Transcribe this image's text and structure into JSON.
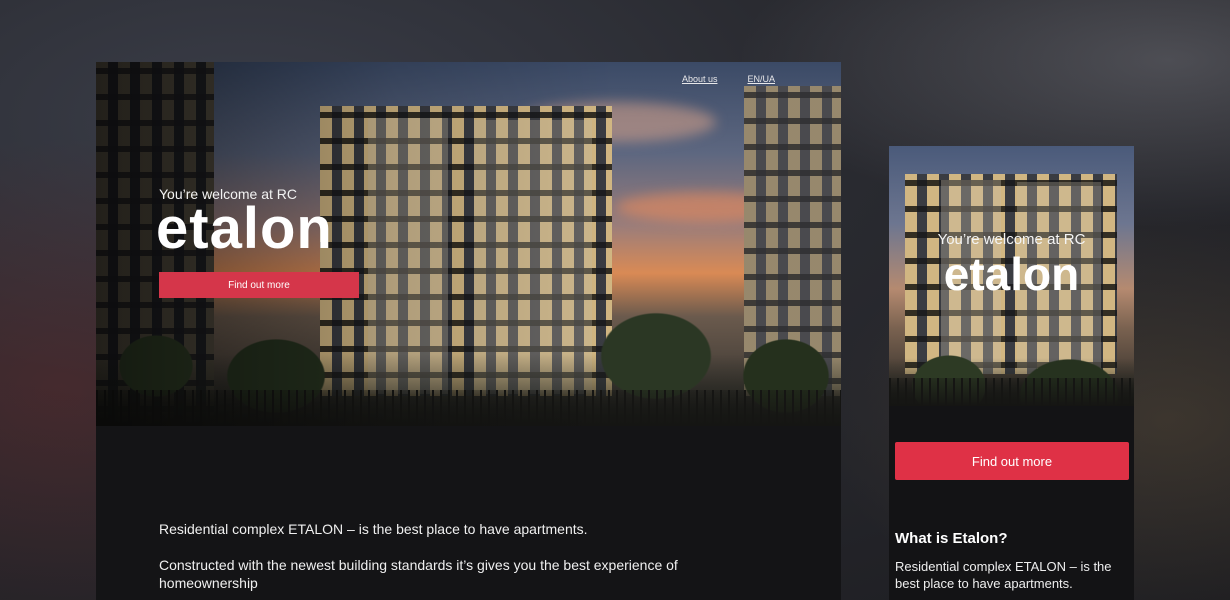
{
  "desktop": {
    "nav": {
      "about": "About us",
      "lang": "EN/UA"
    },
    "hero": {
      "welcome": "You’re welcome at RC",
      "logo": "etalon",
      "cta": "Find out more"
    },
    "description": {
      "line1": "Residential complex ETALON – is the best place to have apartments.",
      "line2": "Constructed with the newest building standards it’s gives you the best experience of homeownership"
    }
  },
  "mobile": {
    "hero": {
      "welcome": "You’re welcome at RC",
      "logo": "etalon"
    },
    "cta": "Find out more",
    "heading": "What is Etalon?",
    "text": "Residential complex ETALON – is the best place to have apartments."
  },
  "colors": {
    "accent": "#d5364a",
    "background": "#141416"
  }
}
